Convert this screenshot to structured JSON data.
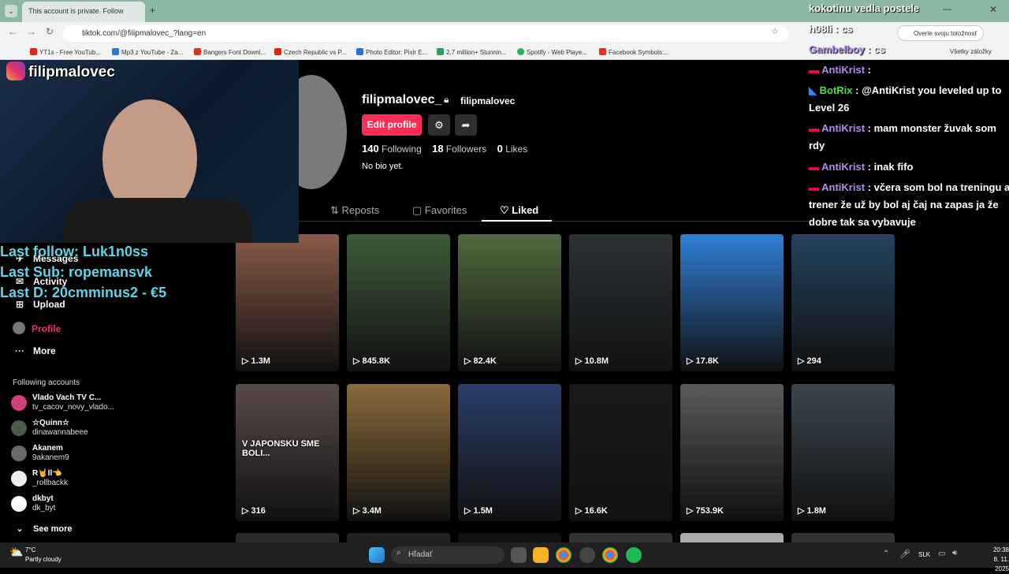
{
  "browser": {
    "tab_title": "This account is private. Follow",
    "url": "tiktok.com/@filipmalovec_?lang=en",
    "verify_label": "Overte svoju totožnosť",
    "bookmarks": [
      "YT1s - Free YouTub...",
      "Mp3 z YouTube - Za...",
      "Bangers Font Downl...",
      "Czech Republic vs P...",
      "Photo Editor: Pixlr E...",
      "2.7 million+ Stunnin...",
      "Spotify - Web Playe...",
      "Facebook Symbols:..."
    ],
    "all_bookmarks": "Všetky záložky"
  },
  "sidebar": {
    "items": [
      "Messages",
      "Activity",
      "Upload",
      "Profile",
      "More"
    ],
    "following_heading": "Following accounts",
    "accounts": [
      {
        "name": "Vlado Vach TV C...",
        "handle": "tv_cacov_novy_vlado..."
      },
      {
        "name": "☆Quinn☆",
        "handle": "dinawannabeee"
      },
      {
        "name": "Akanem",
        "handle": "9akanem9"
      },
      {
        "name": "R🤘ll👈",
        "handle": "_rollbackk"
      },
      {
        "name": "dkbyt",
        "handle": "dk_byt"
      }
    ],
    "see_more": "See more"
  },
  "profile": {
    "username": "filipmalovec_",
    "nickname": "filipmalovec",
    "edit_label": "Edit profile",
    "following_count": "140",
    "following_label": "Following",
    "followers_count": "18",
    "followers_label": "Followers",
    "likes_count": "0",
    "likes_label": "Likes",
    "bio": "No bio yet.",
    "tabs": [
      "Reposts",
      "Favorites",
      "Liked"
    ]
  },
  "videos": [
    {
      "views": "1.3M",
      "color": "#8a5a48"
    },
    {
      "views": "845.8K",
      "color": "#3e5a3a"
    },
    {
      "views": "82.4K",
      "color": "#4f6a3e"
    },
    {
      "views": "10.8M",
      "color": "#2b3236"
    },
    {
      "views": "17.8K",
      "color": "#2f7fd8"
    },
    {
      "views": "294",
      "color": "#24435e"
    },
    {
      "views": "316",
      "color": "#5a4a4a",
      "caption": "V JAPONSKU SME BOLI..."
    },
    {
      "views": "3.4M",
      "color": "#8a6a3a"
    },
    {
      "views": "1.5M",
      "color": "#2a3e6a"
    },
    {
      "views": "16.6K",
      "color": "#1a1a1a"
    },
    {
      "views": "753.9K",
      "color": "#5a5a5a"
    },
    {
      "views": "1.8M",
      "color": "#3a4650"
    }
  ],
  "stream": {
    "instagram_handle": "filipmalovec",
    "last_follow": "Last follow: Luk1n0ss",
    "last_sub": "Last Sub: ropemansvk",
    "last_d": "Last D: 20cmminus2 - €5"
  },
  "chat": [
    {
      "user": "",
      "text": "kokotinu vedla postele"
    },
    {
      "user": "h08li",
      "text": ": cs"
    },
    {
      "user": "Gambelboy",
      "text": ": cs"
    },
    {
      "user": "AntiKrist",
      "text": ":"
    },
    {
      "user": "BotRix",
      "text": ": @AntiKrist you leveled up to Level 26"
    },
    {
      "user": "AntiKrist",
      "text": ": mam monster žuvak som rdy"
    },
    {
      "user": "AntiKrist",
      "text": ": inak fifo"
    },
    {
      "user": "AntiKrist",
      "text": ": včera som bol na treningu a trener že už by bol aj čaj na zapas ja že dobre tak sa vybavuje"
    }
  ],
  "taskbar": {
    "weather_temp": "7°C",
    "weather_desc": "Partly cloudy",
    "search_placeholder": "Hľadať",
    "lang": "SLK",
    "time": "20:38",
    "date": "8. 11. 2025"
  },
  "colors": {
    "accent": "#fe2c55",
    "alert_text": "#5fd4e8",
    "chat_user": "#b48cf0",
    "bot_user": "#56d94a"
  }
}
